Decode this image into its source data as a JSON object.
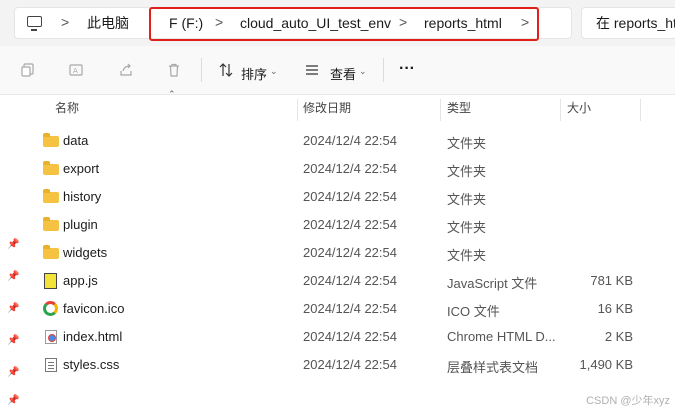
{
  "address_bar": {
    "crumbs": [
      "此电脑",
      "F (F:)",
      "cloud_auto_UI_test_env",
      "reports_html"
    ],
    "separator": ">",
    "search_placeholder": "在 reports_html 中搜索"
  },
  "toolbar": {
    "sort_label": "排序",
    "view_label": "查看",
    "more_label": "···"
  },
  "columns": {
    "name": "名称",
    "date": "修改日期",
    "type": "类型",
    "size": "大小"
  },
  "files": [
    {
      "name": "data",
      "date": "2024/12/4 22:54",
      "type": "文件夹",
      "size": "",
      "icon": "folder"
    },
    {
      "name": "export",
      "date": "2024/12/4 22:54",
      "type": "文件夹",
      "size": "",
      "icon": "folder"
    },
    {
      "name": "history",
      "date": "2024/12/4 22:54",
      "type": "文件夹",
      "size": "",
      "icon": "folder"
    },
    {
      "name": "plugin",
      "date": "2024/12/4 22:54",
      "type": "文件夹",
      "size": "",
      "icon": "folder"
    },
    {
      "name": "widgets",
      "date": "2024/12/4 22:54",
      "type": "文件夹",
      "size": "",
      "icon": "folder"
    },
    {
      "name": "app.js",
      "date": "2024/12/4 22:54",
      "type": "JavaScript 文件",
      "size": "781 KB",
      "icon": "js"
    },
    {
      "name": "favicon.ico",
      "date": "2024/12/4 22:54",
      "type": "ICO 文件",
      "size": "16 KB",
      "icon": "ico"
    },
    {
      "name": "index.html",
      "date": "2024/12/4 22:54",
      "type": "Chrome HTML D...",
      "size": "2 KB",
      "icon": "chrome"
    },
    {
      "name": "styles.css",
      "date": "2024/12/4 22:54",
      "type": "层叠样式表文档",
      "size": "1,490 KB",
      "icon": "css"
    }
  ],
  "watermark": "CSDN @少年xyz",
  "colors": {
    "highlight": "#e0201b",
    "folder": "#f5c242"
  }
}
